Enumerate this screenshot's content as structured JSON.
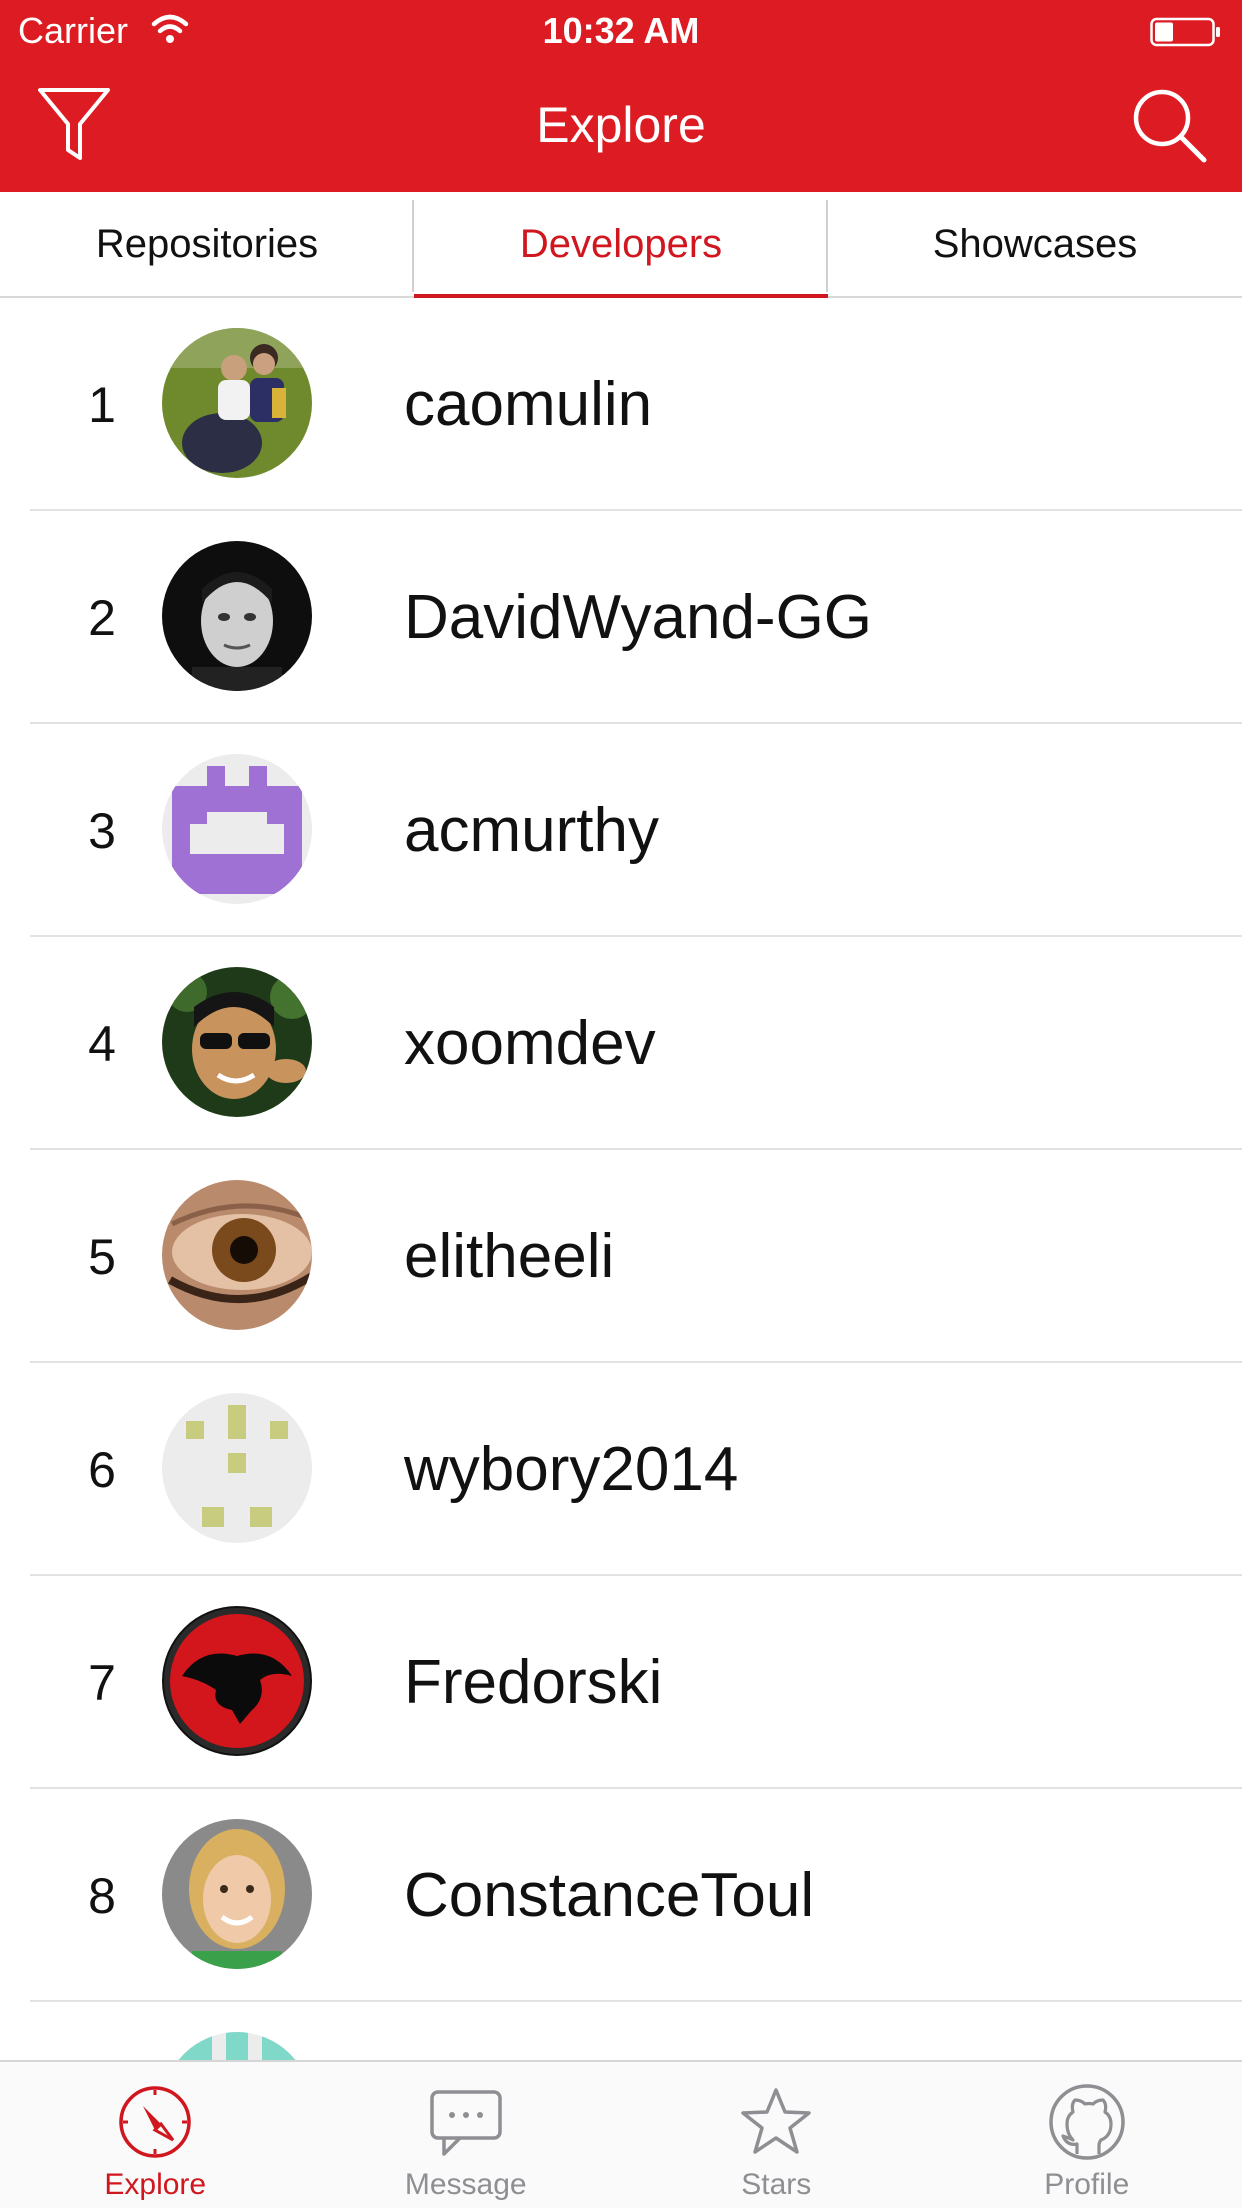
{
  "status_bar": {
    "carrier": "Carrier",
    "time": "10:32 AM"
  },
  "nav": {
    "title": "Explore"
  },
  "tabs": [
    {
      "label": "Repositories",
      "active": false
    },
    {
      "label": "Developers",
      "active": true
    },
    {
      "label": "Showcases",
      "active": false
    }
  ],
  "developers": [
    {
      "rank": "1",
      "username": "caomulin"
    },
    {
      "rank": "2",
      "username": "DavidWyand-GG"
    },
    {
      "rank": "3",
      "username": "acmurthy"
    },
    {
      "rank": "4",
      "username": "xoomdev"
    },
    {
      "rank": "5",
      "username": "elitheeli"
    },
    {
      "rank": "6",
      "username": "wybory2014"
    },
    {
      "rank": "7",
      "username": "Fredorski"
    },
    {
      "rank": "8",
      "username": "ConstanceToul"
    }
  ],
  "tabbar": [
    {
      "label": "Explore",
      "icon": "compass-icon",
      "active": true
    },
    {
      "label": "Message",
      "icon": "chat-bubble-icon",
      "active": false
    },
    {
      "label": "Stars",
      "icon": "star-icon",
      "active": false
    },
    {
      "label": "Profile",
      "icon": "github-octocat-icon",
      "active": false
    }
  ],
  "colors": {
    "brand_red": "#dd1b22",
    "active_red": "#d0161e",
    "inactive_gray": "#8e8e93"
  }
}
